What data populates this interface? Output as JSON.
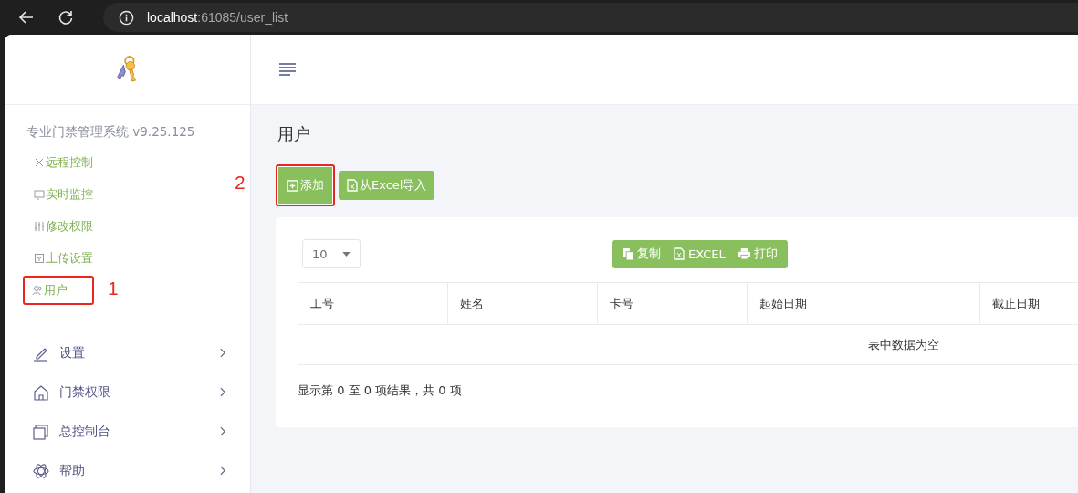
{
  "browser": {
    "url_host": "localhost",
    "url_rest": ":61085/user_list"
  },
  "sidebar": {
    "version": "专业门禁管理系统 v9.25.125",
    "sub_items": [
      {
        "label": "远程控制",
        "highlighted": false
      },
      {
        "label": "实时监控",
        "highlighted": false
      },
      {
        "label": "修改权限",
        "highlighted": false
      },
      {
        "label": "上传设置",
        "highlighted": false
      },
      {
        "label": "用户",
        "highlighted": true
      }
    ],
    "menu": [
      {
        "label": "设置"
      },
      {
        "label": "门禁权限"
      },
      {
        "label": "总控制台"
      },
      {
        "label": "帮助"
      }
    ]
  },
  "page": {
    "title": "用户",
    "buttons": [
      {
        "label": "添加",
        "highlighted": true
      },
      {
        "label": "从Excel导入",
        "highlighted": false
      }
    ],
    "page_length": "10",
    "export_buttons": [
      {
        "label": "复制"
      },
      {
        "label": "EXCEL"
      },
      {
        "label": "打印"
      }
    ],
    "table": {
      "columns": [
        "工号",
        "姓名",
        "卡号",
        "起始日期",
        "截止日期"
      ],
      "empty_text": "表中数据为空"
    },
    "info": "显示第 0 至 0 项结果，共 0 项"
  },
  "annotations": [
    {
      "label": "1"
    },
    {
      "label": "2"
    }
  ]
}
